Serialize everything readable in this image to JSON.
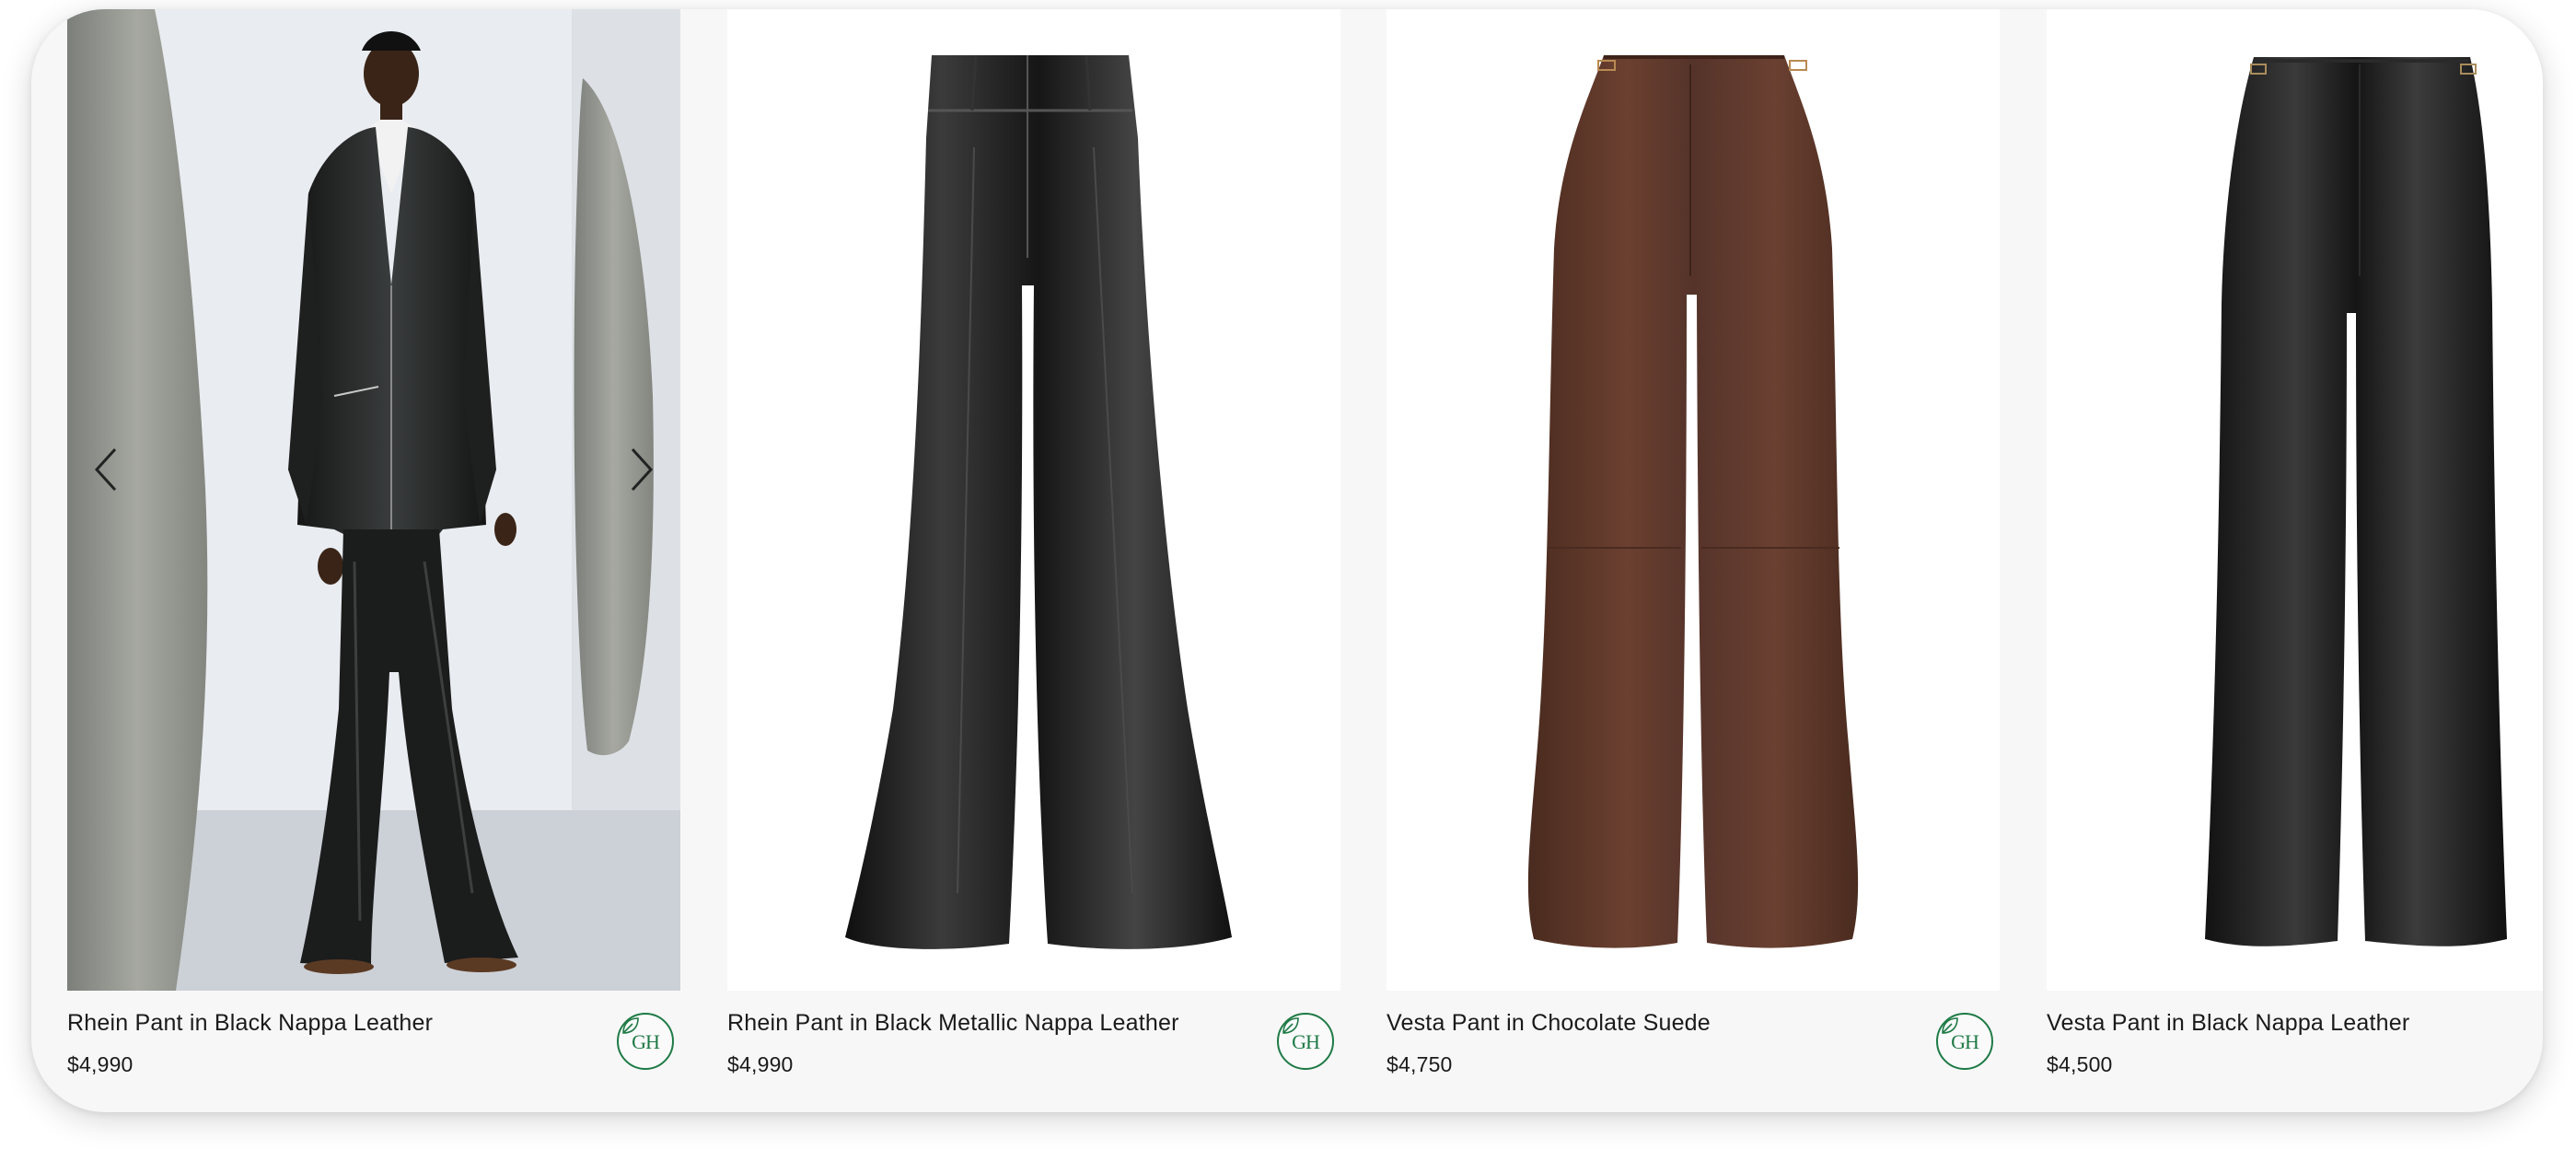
{
  "products": [
    {
      "name": "Rhein Pant in Black Nappa Leather",
      "price": "$4,990",
      "badge": "GH",
      "image": "model wearing black leather blazer and flared pants"
    },
    {
      "name": "Rhein Pant in Black Metallic Nappa Leather",
      "price": "$4,990",
      "badge": "GH",
      "image": "black flared leather pants"
    },
    {
      "name": "Vesta Pant in Chocolate Suede",
      "price": "$4,750",
      "badge": "GH",
      "image": "chocolate brown suede flared pants"
    },
    {
      "name": "Vesta Pant in Black Nappa Leather",
      "price": "$4,500",
      "badge": "",
      "image": "black straight leather pants"
    }
  ],
  "carousel": {
    "prev_icon": "chevron-left-icon",
    "next_icon": "chevron-right-icon"
  },
  "colors": {
    "badge_green": "#1f7a46",
    "card_background": "#f7f7f7",
    "leather_black": "#1c1c1c",
    "suede_brown": "#5a3526"
  }
}
